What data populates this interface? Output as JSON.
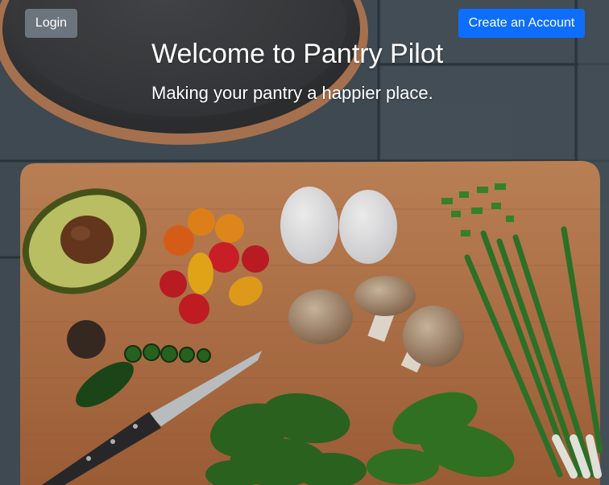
{
  "header": {
    "login_label": "Login",
    "create_account_label": "Create an Account"
  },
  "hero": {
    "title": "Welcome to Pantry Pilot",
    "subtitle": "Making your pantry a happier place.",
    "background_image": "cutting-board-with-vegetables"
  },
  "colors": {
    "login_button": "#6c757d",
    "create_button": "#0d6efd"
  }
}
